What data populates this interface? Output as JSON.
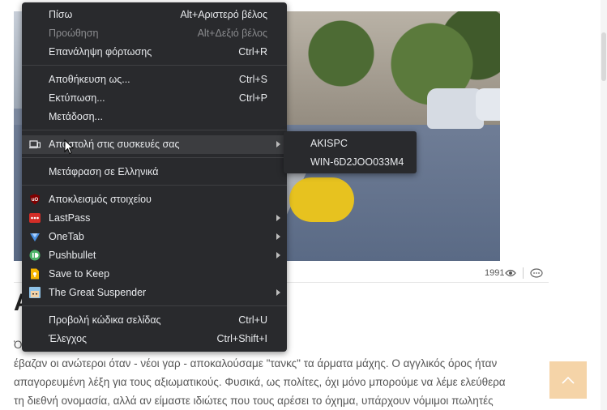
{
  "menu": {
    "items": [
      {
        "label": "Πίσω",
        "shortcut": "Alt+Αριστερό βέλος"
      },
      {
        "label": "Προώθηση",
        "shortcut": "Alt+Δεξιό βέλος"
      },
      {
        "label": "Επανάληψη φόρτωσης",
        "shortcut": "Ctrl+R"
      },
      {
        "label": "Αποθήκευση ως...",
        "shortcut": "Ctrl+S"
      },
      {
        "label": "Εκτύπωση...",
        "shortcut": "Ctrl+P"
      },
      {
        "label": "Μετάδοση..."
      },
      {
        "label": "Αποστολή στις συσκευές σας"
      },
      {
        "label": "Μετάφραση σε Ελληνικά"
      },
      {
        "label": "Αποκλεισμός στοιχείου"
      },
      {
        "label": "LastPass"
      },
      {
        "label": "OneTab"
      },
      {
        "label": "Pushbullet"
      },
      {
        "label": "Save to Keep"
      },
      {
        "label": "The Great Suspender"
      },
      {
        "label": "Προβολή κώδικα σελίδας",
        "shortcut": "Ctrl+U"
      },
      {
        "label": "Έλεγχος",
        "shortcut": "Ctrl+Shift+I"
      }
    ]
  },
  "submenu": {
    "devices": [
      "AKISPC",
      "WIN-6D2JOO033M4"
    ]
  },
  "article": {
    "views": "1991",
    "headline": "Α                              ατή Στην Ελλάδα?",
    "lines": [
      "Ό                                                         γα, θα θυμόμαστε σίγουρα τις φωνές που μας",
      "έβαζαν οι ανώτεροι όταν - νέοι γαρ - αποκαλούσαμε \"τανκς\" τα άρματα μάχης. Ο αγγλικός όρος ήταν",
      "απαγορευμένη λέξη για τους αξιωματικούς. Φυσικά, ως πολίτες, όχι μόνο μπορούμε να λέμε ελεύθερα",
      "τη διεθνή ονομασία, αλλά αν είμαστε ιδιώτες που τους αρέσει το όχημα, υπάρχουν νόμιμοι πωλητές"
    ]
  },
  "colors": {
    "menu_bg": "#292a2d",
    "menu_text": "#e8eaed",
    "scroll_top_button": "#f5d4a8"
  }
}
